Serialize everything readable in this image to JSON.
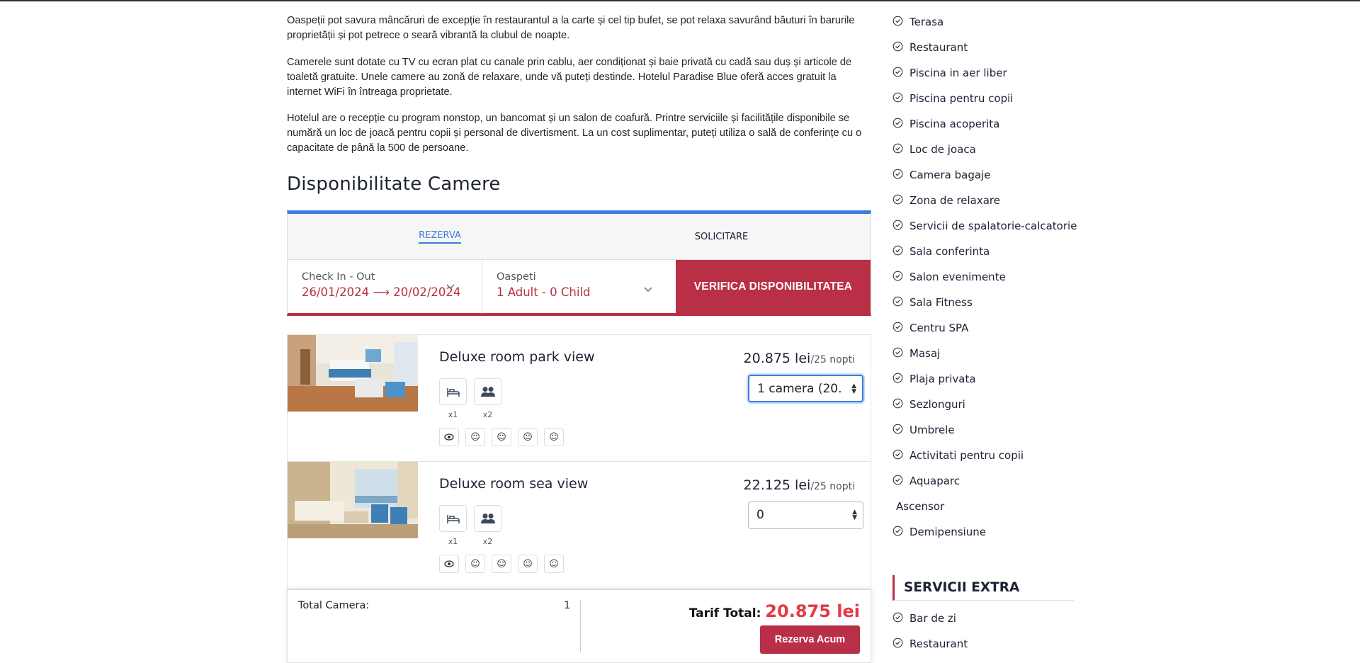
{
  "description": {
    "p1": "Oaspeții pot savura mâncăruri de excepție în restaurantul a la carte și cel tip bufet, se pot relaxa savurând băuturi în barurile proprietății și pot petrece o seară vibrantă la clubul de noapte.",
    "p2": "Camerele sunt dotate cu TV cu ecran plat cu canale prin cablu, aer condiționat și baie privată cu cadă sau duș și articole de toaletă gratuite. Unele camere au zonă de relaxare, unde vă puteți destinde. Hotelul Paradise Blue oferă acces gratuit la internet WiFi în întreaga proprietate.",
    "p3": "Hotelul are o recepție cu program nonstop, un bancomat și un salon de coafură. Printre serviciile și facilitățile disponibile se numără un loc de joacă pentru copii și personal de divertisment. La un cost suplimentar, puteți utiliza o sală de conferințe cu o capacitate de până la 500 de persoane."
  },
  "availability": {
    "title": "Disponibilitate Camere",
    "tabs": [
      "REZERVA",
      "SOLICITARE"
    ],
    "checkin_label": "Check In - Out",
    "checkin_from": "26/01/2024",
    "checkin_arrow": "⟶",
    "checkin_to": "20/02/2024",
    "guests_label": "Oaspeti",
    "guests_value": "1 Adult - 0 Child",
    "verify_button": "VERIFICA DISPONIBILITATEA"
  },
  "rooms": [
    {
      "name": "Deluxe room park view",
      "price": "20.875 lei",
      "per": "/25 nopti",
      "select_value": "1 camera    (20.",
      "beds": "x1",
      "persons": "x2"
    },
    {
      "name": "Deluxe room sea view",
      "price": "22.125 lei",
      "per": "/25 nopti",
      "select_value": "0",
      "beds": "x1",
      "persons": "x2"
    }
  ],
  "total": {
    "label": "Total Camera:",
    "count": "1",
    "tarif_label": "Tarif Total:",
    "tarif_value": "20.875 lei",
    "book_button": "Rezerva Acum"
  },
  "facilities": [
    "Terasa",
    "Restaurant",
    "Piscina in aer liber",
    "Piscina pentru copii",
    "Piscina acoperita",
    "Loc de joaca",
    "Camera bagaje",
    "Zona de relaxare",
    "Servicii de spalatorie-calcatorie",
    "Sala conferinta",
    "Salon evenimente",
    "Sala Fitness",
    "Centru SPA",
    "Masaj",
    "Plaja privata",
    "Sezlonguri",
    "Umbrele",
    "Activitati pentru copii",
    "Aquaparc",
    "Ascensor",
    "Demipensiune"
  ],
  "extra": {
    "title": "SERVICII EXTRA",
    "items": [
      "Bar de zi",
      "Restaurant"
    ]
  },
  "colors": {
    "accent_blue": "#3b7ddd",
    "brand_red": "#b92f45",
    "price_red": "#e63946"
  },
  "icons": {
    "check": "check-circle-icon",
    "bed": "bed-icon",
    "people": "people-icon",
    "amenity": "smiley-icon",
    "eye": "eye-icon",
    "chevron": "chevron-down-icon"
  }
}
